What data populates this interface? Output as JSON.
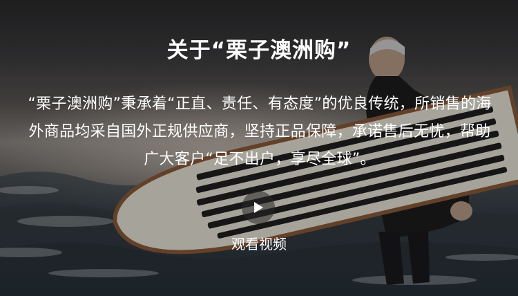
{
  "section": {
    "title": "关于“栗子澳洲购”",
    "description": "“栗子澳洲购”秉承着“正直、责任、有态度”的优良传统，所销售的海外商品均采自国外正规供应商，坚持正品保障，承诺售后无忧，帮助广大客户“足不出户，享尽全球”。"
  },
  "video": {
    "play_icon": "play-icon",
    "watch_label": "观看视频"
  },
  "colors": {
    "text": "#ffffff",
    "board_stripe": "#1f1f1f",
    "board_body": "#e7e3d6",
    "board_rim": "#8a5a3a"
  }
}
